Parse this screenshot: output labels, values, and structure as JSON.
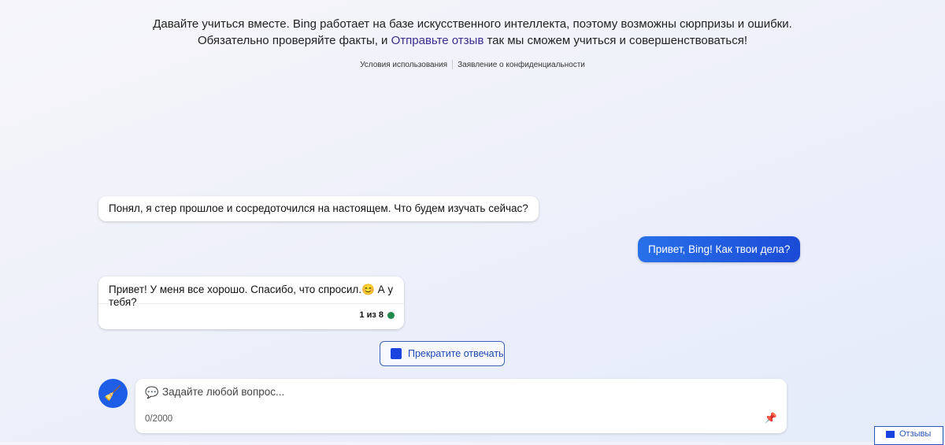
{
  "disclaimer": {
    "line1": "Давайте учиться вместе. Bing работает на базе искусственного интеллекта, поэтому возможны сюрпризы и ошибки.",
    "line2_pre": "Обязательно проверяйте факты, и ",
    "feedback_link": "Отправьте отзыв",
    "line2_post": " так мы сможем учиться и совершенствоваться!"
  },
  "links": {
    "terms": "Условия использования",
    "privacy": "Заявление о конфиденциальности"
  },
  "messages": [
    {
      "role": "bot",
      "text": "Понял, я стер прошлое и сосредоточился на настоящем. Что будем изучать сейчас?"
    },
    {
      "role": "user",
      "text": "Привет, Bing! Как твои дела?"
    },
    {
      "role": "bot",
      "text": "Привет! У меня все хорошо. Спасибо, что спросил.",
      "emoji": "😊",
      "text2": " А у тебя?",
      "counter": "1 из 8"
    }
  ],
  "stop_label": "Прекратите отвечать",
  "input": {
    "placeholder": "Задайте любой вопрос...",
    "counter": "0/2000"
  },
  "feedback_label": "Отзывы"
}
